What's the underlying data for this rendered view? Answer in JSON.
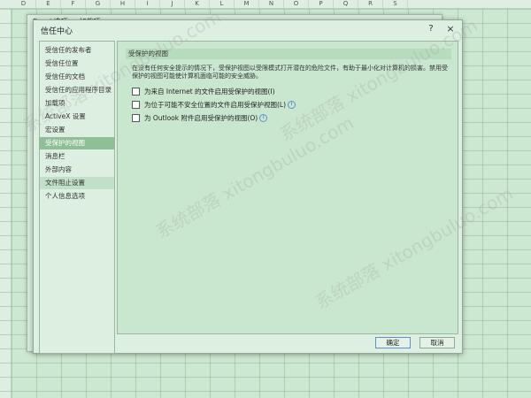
{
  "columns": [
    "D",
    "E",
    "F",
    "G",
    "H",
    "I",
    "J",
    "K",
    "L",
    "M",
    "N",
    "O",
    "P",
    "Q",
    "R",
    "S"
  ],
  "back_dialog": {
    "title": "Excel 选项   ... 加载项"
  },
  "dialog": {
    "title": "信任中心",
    "help": "?",
    "close": "×"
  },
  "sidebar": {
    "items": [
      {
        "label": "受信任的发布者"
      },
      {
        "label": "受信任位置"
      },
      {
        "label": "受信任的文档"
      },
      {
        "label": "受信任的应用程序目录"
      },
      {
        "label": "加载项"
      },
      {
        "label": "ActiveX 设置"
      },
      {
        "label": "宏设置"
      },
      {
        "label": "受保护的视图"
      },
      {
        "label": "消息栏"
      },
      {
        "label": "外部内容"
      },
      {
        "label": "文件阻止设置"
      },
      {
        "label": "个人信息选项"
      }
    ],
    "active_index": 7
  },
  "content": {
    "section_title": "受保护的视图",
    "description": "在没有任何安全提示的情况下，受保护视图以受限模式打开潜在的危险文件，有助于最小化对计算机的损害。禁用受保护的视图可能使计算机面临可能的安全威胁。",
    "options": [
      {
        "label": "为来自 Internet 的文件启用受保护的视图(I)",
        "checked": false,
        "info": false
      },
      {
        "label": "为位于可能不安全位置的文件启用受保护视图(L)",
        "checked": false,
        "info": true
      },
      {
        "label": "为 Outlook 附件启用受保护的视图(O)",
        "checked": false,
        "info": true
      }
    ]
  },
  "buttons": {
    "ok": "确定",
    "cancel": "取消"
  },
  "watermark": "系统部落 xitongbuluo.com"
}
